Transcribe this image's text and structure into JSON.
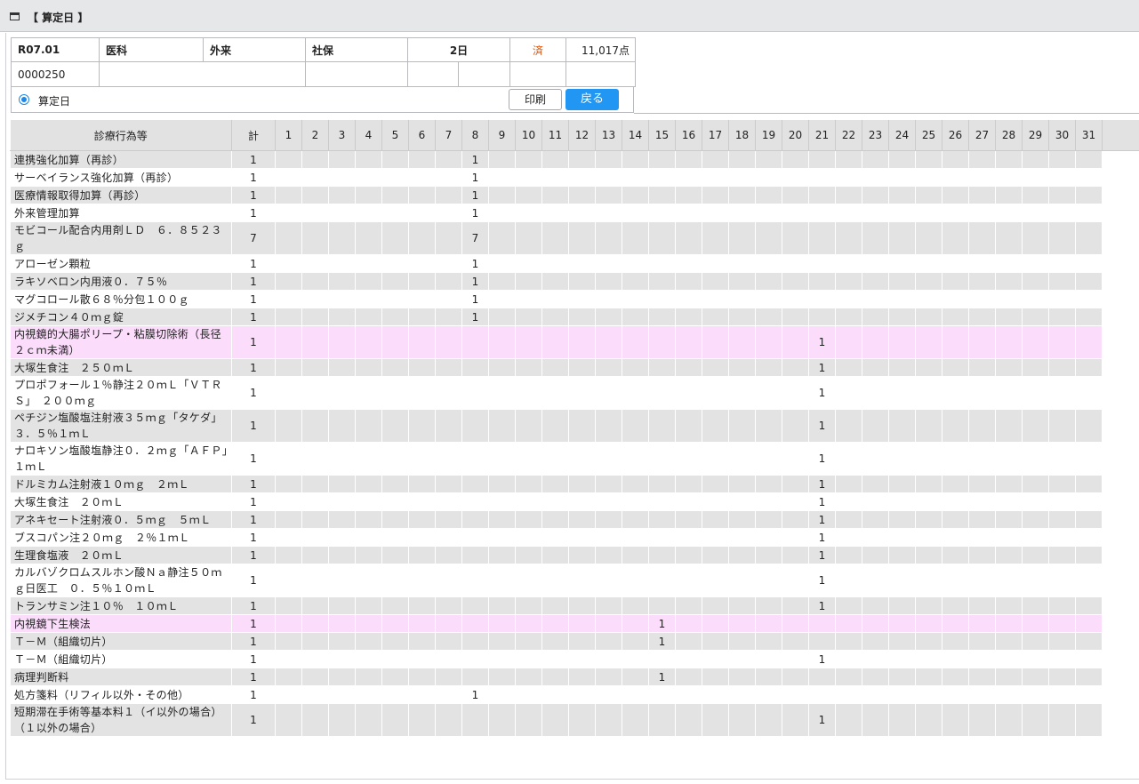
{
  "window": {
    "title": "【 算定日 】"
  },
  "info": {
    "era_month": "R07.01",
    "department": "医科",
    "visit_type": "外来",
    "insurance": "社保",
    "days": "2日",
    "status": "済",
    "points": "11,017点",
    "patient_id": "0000250",
    "radio_label": "算定日",
    "print_label": "印刷",
    "back_label": "戻る"
  },
  "colors": {
    "status": "#e65100",
    "back_button": "#2196f3",
    "highlight_row": "#fbdcfb",
    "stripe": "#e3e3e3"
  },
  "grid": {
    "name_header": "診療行為等",
    "total_header": "計",
    "days": [
      "1",
      "2",
      "3",
      "4",
      "5",
      "6",
      "7",
      "8",
      "9",
      "10",
      "11",
      "12",
      "13",
      "14",
      "15",
      "16",
      "17",
      "18",
      "19",
      "20",
      "21",
      "22",
      "23",
      "24",
      "25",
      "26",
      "27",
      "28",
      "29",
      "30",
      "31"
    ],
    "rows": [
      {
        "name": "連携強化加算（再診）",
        "total": "1",
        "day": "8",
        "count": "1",
        "highlight": false
      },
      {
        "name": "サーベイランス強化加算（再診）",
        "total": "1",
        "day": "8",
        "count": "1",
        "highlight": false
      },
      {
        "name": "医療情報取得加算（再診）",
        "total": "1",
        "day": "8",
        "count": "1",
        "highlight": false
      },
      {
        "name": "外来管理加算",
        "total": "1",
        "day": "8",
        "count": "1",
        "highlight": false
      },
      {
        "name": "モビコール配合内用剤ＬＤ　６．８５２３ｇ",
        "total": "7",
        "day": "8",
        "count": "7",
        "highlight": false
      },
      {
        "name": "アローゼン顆粒",
        "total": "1",
        "day": "8",
        "count": "1",
        "highlight": false
      },
      {
        "name": "ラキソベロン内用液０．７５％",
        "total": "1",
        "day": "8",
        "count": "1",
        "highlight": false
      },
      {
        "name": "マグコロール散６８％分包１００ｇ",
        "total": "1",
        "day": "8",
        "count": "1",
        "highlight": false
      },
      {
        "name": "ジメチコン４０ｍｇ錠",
        "total": "1",
        "day": "8",
        "count": "1",
        "highlight": false
      },
      {
        "name": "内視鏡的大腸ポリープ・粘膜切除術（長径２ｃｍ未満）",
        "total": "1",
        "day": "21",
        "count": "1",
        "highlight": true
      },
      {
        "name": "大塚生食注　２５０ｍＬ",
        "total": "1",
        "day": "21",
        "count": "1",
        "highlight": false
      },
      {
        "name": "プロポフォール１％静注２０ｍＬ「ＶＴＲＳ」　２００ｍｇ",
        "total": "1",
        "day": "21",
        "count": "1",
        "highlight": false
      },
      {
        "name": "ペチジン塩酸塩注射液３５ｍｇ「タケダ」３．５％１ｍＬ",
        "total": "1",
        "day": "21",
        "count": "1",
        "highlight": false
      },
      {
        "name": "ナロキソン塩酸塩静注０．２ｍｇ「ＡＦＰ」１ｍＬ",
        "total": "1",
        "day": "21",
        "count": "1",
        "highlight": false
      },
      {
        "name": "ドルミカム注射液１０ｍｇ　２ｍＬ",
        "total": "1",
        "day": "21",
        "count": "1",
        "highlight": false
      },
      {
        "name": "大塚生食注　２０ｍＬ",
        "total": "1",
        "day": "21",
        "count": "1",
        "highlight": false
      },
      {
        "name": "アネキセート注射液０．５ｍｇ　５ｍＬ",
        "total": "1",
        "day": "21",
        "count": "1",
        "highlight": false
      },
      {
        "name": "ブスコパン注２０ｍｇ　２％１ｍＬ",
        "total": "1",
        "day": "21",
        "count": "1",
        "highlight": false
      },
      {
        "name": "生理食塩液　２０ｍＬ",
        "total": "1",
        "day": "21",
        "count": "1",
        "highlight": false
      },
      {
        "name": "カルバゾクロムスルホン酸Ｎａ静注５０ｍｇ日医工　０．５％１０ｍＬ",
        "total": "1",
        "day": "21",
        "count": "1",
        "highlight": false
      },
      {
        "name": "トランサミン注１０％　１０ｍＬ",
        "total": "1",
        "day": "21",
        "count": "1",
        "highlight": false
      },
      {
        "name": "内視鏡下生検法",
        "total": "1",
        "day": "15",
        "count": "1",
        "highlight": true
      },
      {
        "name": "Ｔ－Ｍ（組織切片）",
        "total": "1",
        "day": "15",
        "count": "1",
        "highlight": false
      },
      {
        "name": "Ｔ－Ｍ（組織切片）",
        "total": "1",
        "day": "21",
        "count": "1",
        "highlight": false
      },
      {
        "name": "病理判断料",
        "total": "1",
        "day": "15",
        "count": "1",
        "highlight": false
      },
      {
        "name": "処方箋料（リフィル以外・その他）",
        "total": "1",
        "day": "8",
        "count": "1",
        "highlight": false
      },
      {
        "name": "短期滞在手術等基本料１（イ以外の場合）（１以外の場合）",
        "total": "1",
        "day": "21",
        "count": "1",
        "highlight": false
      }
    ]
  }
}
